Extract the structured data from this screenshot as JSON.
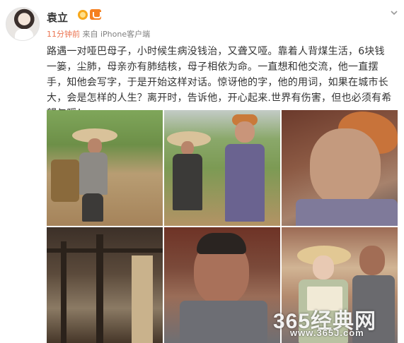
{
  "post": {
    "user_name": "袁立",
    "time": "11分钟前",
    "source": "来自 iPhone客户端",
    "text": "路遇一对哑巴母子，小时候生病没钱治，又聋又哑。靠着人背煤生活，6块钱一篓，尘肺，母亲亦有肺结核，母子相依为命。一直想和他交流，他一直摆手，知他会写字，于是开始这样对话。惊讶他的字，他的用词，如果在城市长大，会是怎样的人生？离开时，告诉他，开心起来.世界有伤害，但也必须有希望与暖！",
    "icons": {
      "avatar": "avatar-image",
      "vip": "vip-badge-icon",
      "member": "member-badge-icon",
      "expand": "chevron-down-icon"
    }
  },
  "photos": [
    {
      "name": "photo-man-with-basket"
    },
    {
      "name": "photo-son-and-mother-in-field"
    },
    {
      "name": "photo-elderly-mother-portrait"
    },
    {
      "name": "photo-wooden-shack-interior"
    },
    {
      "name": "photo-son-portrait"
    },
    {
      "name": "photo-woman-writing-with-son"
    }
  ],
  "watermark": {
    "main": "365经典网",
    "url": "www.365J.com"
  },
  "colors": {
    "time_accent": "#eb7350",
    "meta_gray": "#808080",
    "text": "#333333"
  }
}
